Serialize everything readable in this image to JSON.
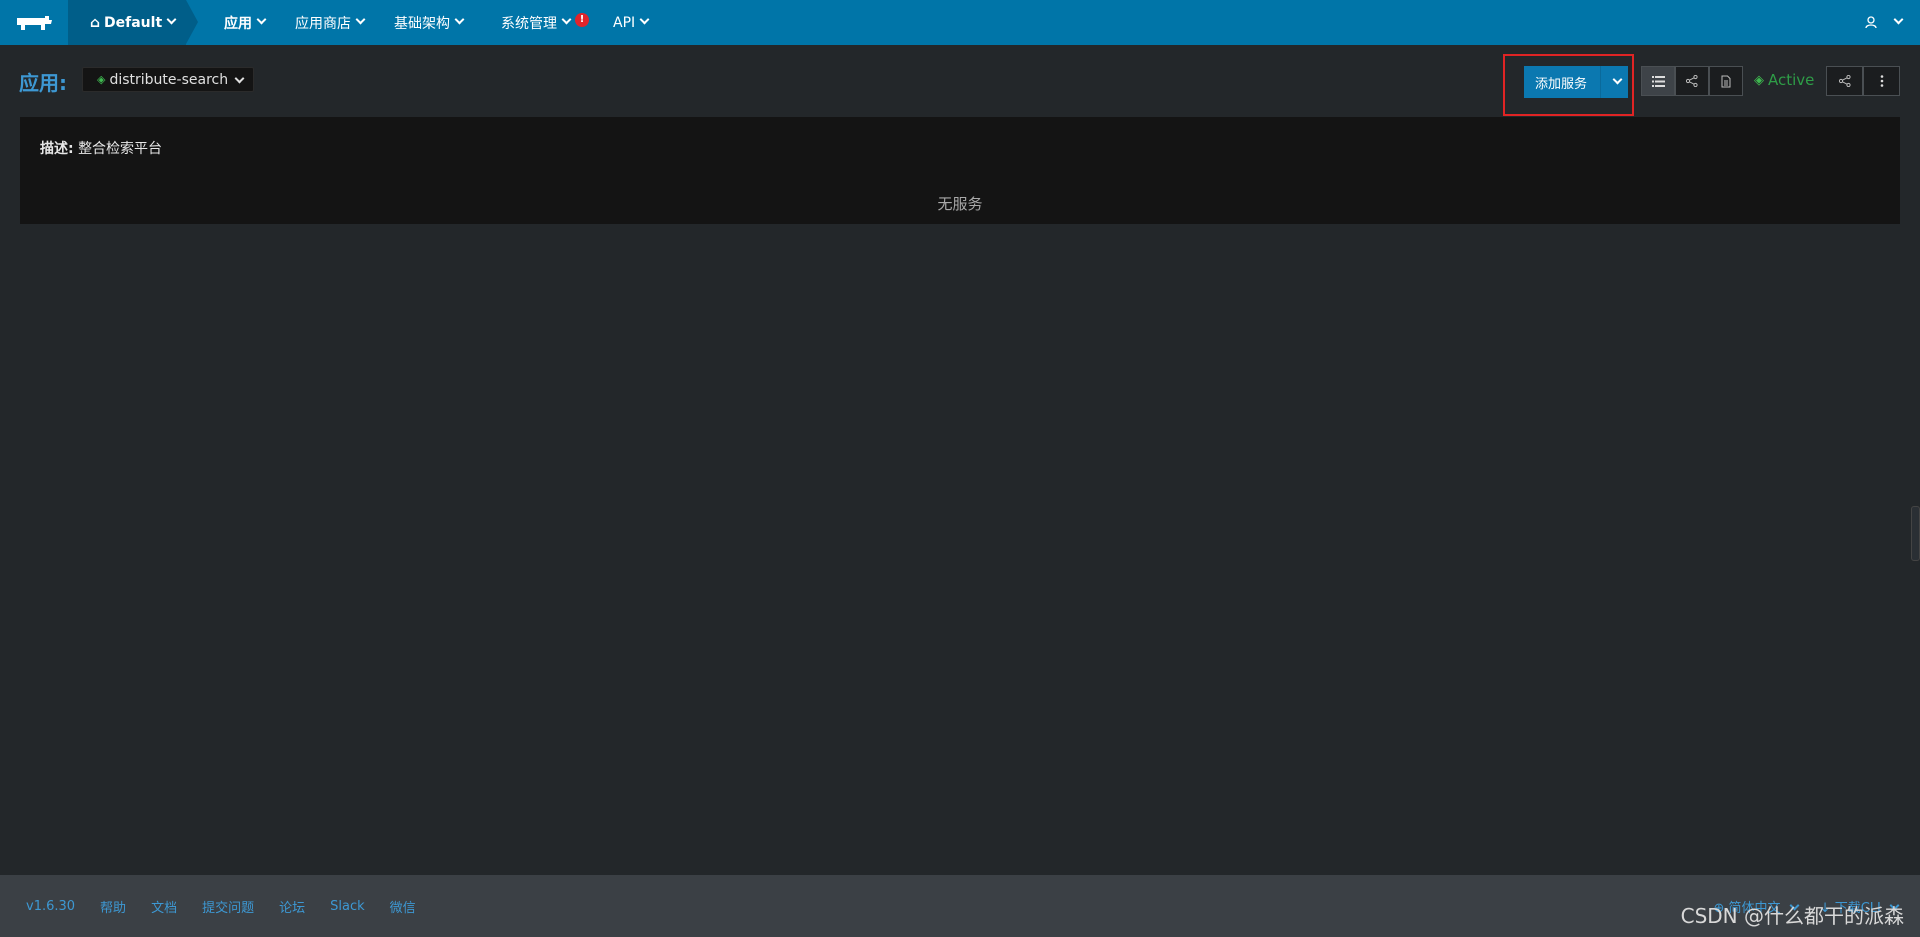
{
  "nav": {
    "environment": "Default",
    "items": [
      {
        "label": "应用",
        "active": true
      },
      {
        "label": "应用商店"
      },
      {
        "label": "基础架构"
      },
      {
        "label": "系统管理",
        "alert": "!"
      },
      {
        "label": "API"
      }
    ]
  },
  "header": {
    "title": "应用:",
    "app_name": "distribute-search",
    "add_button": "添加服务",
    "status": "Active"
  },
  "panel": {
    "desc_label": "描述:",
    "desc_value": "整合检索平台",
    "empty_text": "无服务"
  },
  "footer": {
    "version": "v1.6.30",
    "links": [
      "帮助",
      "文档",
      "提交问题",
      "论坛",
      "Slack",
      "微信"
    ],
    "language": "简体中文",
    "download": "下载CLI",
    "watermark": "CSDN @什么都干的派森"
  },
  "colors": {
    "topbar": "#0075a8",
    "accent": "#3d98d3",
    "highlight": "#e02424",
    "active_status": "#2e9d47"
  }
}
